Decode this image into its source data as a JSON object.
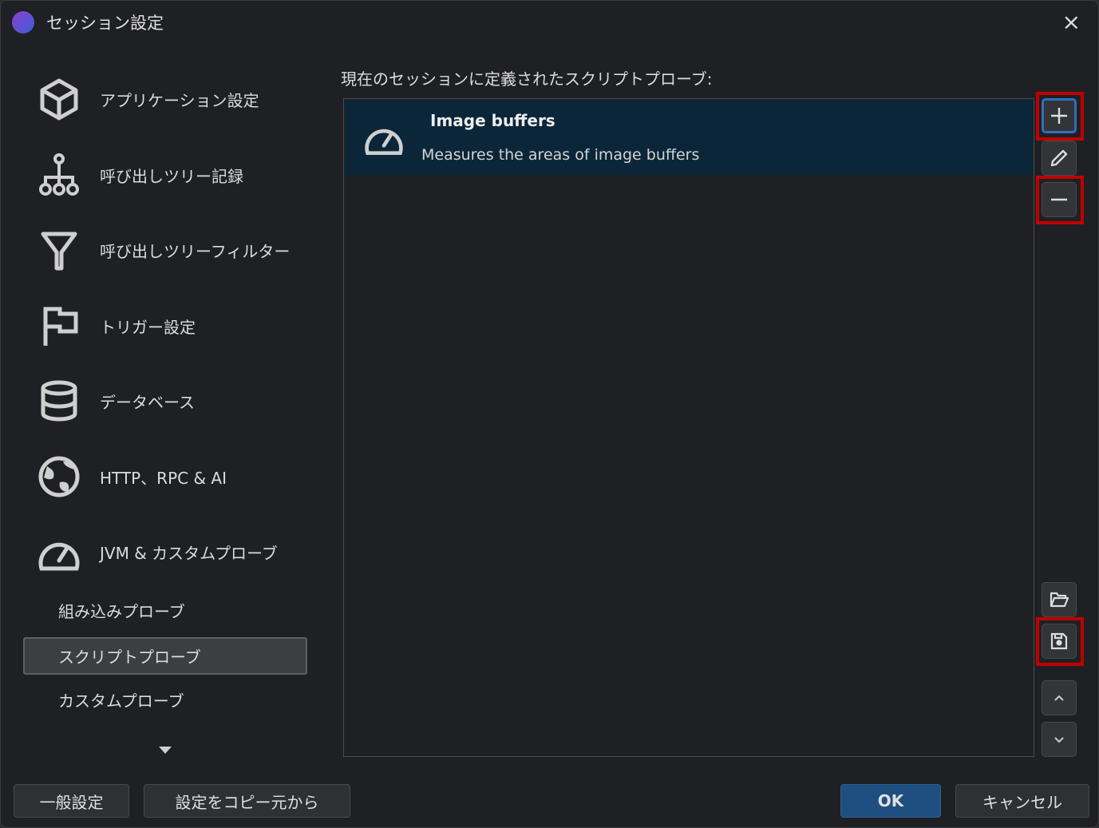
{
  "window": {
    "title": "セッション設定",
    "close_label": "×"
  },
  "sidebar": {
    "items": [
      {
        "label": "アプリケーション設定",
        "icon": "cube-icon"
      },
      {
        "label": "呼び出しツリー記録",
        "icon": "tree-icon"
      },
      {
        "label": "呼び出しツリーフィルター",
        "icon": "filter-icon"
      },
      {
        "label": "トリガー設定",
        "icon": "flag-icon"
      },
      {
        "label": "データベース",
        "icon": "database-icon"
      },
      {
        "label": "HTTP、RPC & AI",
        "icon": "globe-icon"
      },
      {
        "label": "JVM & カスタムプローブ",
        "icon": "gauge-icon"
      }
    ],
    "subitems": [
      {
        "label": "組み込みプローブ"
      },
      {
        "label": "スクリプトプローブ",
        "selected": true
      },
      {
        "label": "カスタムプローブ"
      }
    ]
  },
  "main": {
    "label": "現在のセッションに定義されたスクリプトプローブ:",
    "probes": [
      {
        "title": "Image buffers",
        "description": "Measures the areas of image buffers"
      }
    ]
  },
  "footer": {
    "general": "一般設定",
    "copy": "設定をコピー元から",
    "ok": "OK",
    "cancel": "キャンセル"
  },
  "colors": {
    "accent": "#1f4e80",
    "selection": "#0b2638",
    "highlight": "#c00000"
  }
}
